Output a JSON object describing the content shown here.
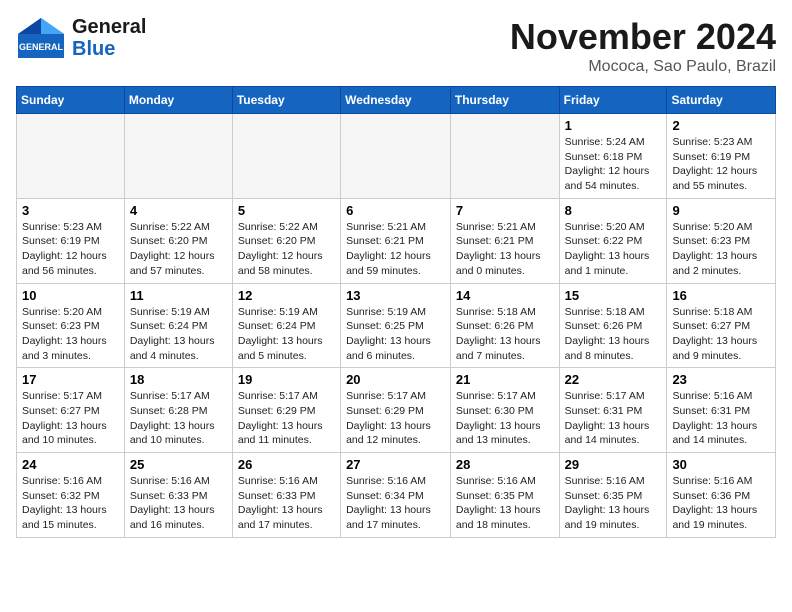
{
  "header": {
    "logo_general": "General",
    "logo_blue": "Blue",
    "month_title": "November 2024",
    "location": "Mococa, Sao Paulo, Brazil"
  },
  "weekdays": [
    "Sunday",
    "Monday",
    "Tuesday",
    "Wednesday",
    "Thursday",
    "Friday",
    "Saturday"
  ],
  "weeks": [
    [
      {
        "day": "",
        "empty": true
      },
      {
        "day": "",
        "empty": true
      },
      {
        "day": "",
        "empty": true
      },
      {
        "day": "",
        "empty": true
      },
      {
        "day": "",
        "empty": true
      },
      {
        "day": "1",
        "sunrise": "Sunrise: 5:24 AM",
        "sunset": "Sunset: 6:18 PM",
        "daylight": "Daylight: 12 hours and 54 minutes."
      },
      {
        "day": "2",
        "sunrise": "Sunrise: 5:23 AM",
        "sunset": "Sunset: 6:19 PM",
        "daylight": "Daylight: 12 hours and 55 minutes."
      }
    ],
    [
      {
        "day": "3",
        "sunrise": "Sunrise: 5:23 AM",
        "sunset": "Sunset: 6:19 PM",
        "daylight": "Daylight: 12 hours and 56 minutes."
      },
      {
        "day": "4",
        "sunrise": "Sunrise: 5:22 AM",
        "sunset": "Sunset: 6:20 PM",
        "daylight": "Daylight: 12 hours and 57 minutes."
      },
      {
        "day": "5",
        "sunrise": "Sunrise: 5:22 AM",
        "sunset": "Sunset: 6:20 PM",
        "daylight": "Daylight: 12 hours and 58 minutes."
      },
      {
        "day": "6",
        "sunrise": "Sunrise: 5:21 AM",
        "sunset": "Sunset: 6:21 PM",
        "daylight": "Daylight: 12 hours and 59 minutes."
      },
      {
        "day": "7",
        "sunrise": "Sunrise: 5:21 AM",
        "sunset": "Sunset: 6:21 PM",
        "daylight": "Daylight: 13 hours and 0 minutes."
      },
      {
        "day": "8",
        "sunrise": "Sunrise: 5:20 AM",
        "sunset": "Sunset: 6:22 PM",
        "daylight": "Daylight: 13 hours and 1 minute."
      },
      {
        "day": "9",
        "sunrise": "Sunrise: 5:20 AM",
        "sunset": "Sunset: 6:23 PM",
        "daylight": "Daylight: 13 hours and 2 minutes."
      }
    ],
    [
      {
        "day": "10",
        "sunrise": "Sunrise: 5:20 AM",
        "sunset": "Sunset: 6:23 PM",
        "daylight": "Daylight: 13 hours and 3 minutes."
      },
      {
        "day": "11",
        "sunrise": "Sunrise: 5:19 AM",
        "sunset": "Sunset: 6:24 PM",
        "daylight": "Daylight: 13 hours and 4 minutes."
      },
      {
        "day": "12",
        "sunrise": "Sunrise: 5:19 AM",
        "sunset": "Sunset: 6:24 PM",
        "daylight": "Daylight: 13 hours and 5 minutes."
      },
      {
        "day": "13",
        "sunrise": "Sunrise: 5:19 AM",
        "sunset": "Sunset: 6:25 PM",
        "daylight": "Daylight: 13 hours and 6 minutes."
      },
      {
        "day": "14",
        "sunrise": "Sunrise: 5:18 AM",
        "sunset": "Sunset: 6:26 PM",
        "daylight": "Daylight: 13 hours and 7 minutes."
      },
      {
        "day": "15",
        "sunrise": "Sunrise: 5:18 AM",
        "sunset": "Sunset: 6:26 PM",
        "daylight": "Daylight: 13 hours and 8 minutes."
      },
      {
        "day": "16",
        "sunrise": "Sunrise: 5:18 AM",
        "sunset": "Sunset: 6:27 PM",
        "daylight": "Daylight: 13 hours and 9 minutes."
      }
    ],
    [
      {
        "day": "17",
        "sunrise": "Sunrise: 5:17 AM",
        "sunset": "Sunset: 6:27 PM",
        "daylight": "Daylight: 13 hours and 10 minutes."
      },
      {
        "day": "18",
        "sunrise": "Sunrise: 5:17 AM",
        "sunset": "Sunset: 6:28 PM",
        "daylight": "Daylight: 13 hours and 10 minutes."
      },
      {
        "day": "19",
        "sunrise": "Sunrise: 5:17 AM",
        "sunset": "Sunset: 6:29 PM",
        "daylight": "Daylight: 13 hours and 11 minutes."
      },
      {
        "day": "20",
        "sunrise": "Sunrise: 5:17 AM",
        "sunset": "Sunset: 6:29 PM",
        "daylight": "Daylight: 13 hours and 12 minutes."
      },
      {
        "day": "21",
        "sunrise": "Sunrise: 5:17 AM",
        "sunset": "Sunset: 6:30 PM",
        "daylight": "Daylight: 13 hours and 13 minutes."
      },
      {
        "day": "22",
        "sunrise": "Sunrise: 5:17 AM",
        "sunset": "Sunset: 6:31 PM",
        "daylight": "Daylight: 13 hours and 14 minutes."
      },
      {
        "day": "23",
        "sunrise": "Sunrise: 5:16 AM",
        "sunset": "Sunset: 6:31 PM",
        "daylight": "Daylight: 13 hours and 14 minutes."
      }
    ],
    [
      {
        "day": "24",
        "sunrise": "Sunrise: 5:16 AM",
        "sunset": "Sunset: 6:32 PM",
        "daylight": "Daylight: 13 hours and 15 minutes."
      },
      {
        "day": "25",
        "sunrise": "Sunrise: 5:16 AM",
        "sunset": "Sunset: 6:33 PM",
        "daylight": "Daylight: 13 hours and 16 minutes."
      },
      {
        "day": "26",
        "sunrise": "Sunrise: 5:16 AM",
        "sunset": "Sunset: 6:33 PM",
        "daylight": "Daylight: 13 hours and 17 minutes."
      },
      {
        "day": "27",
        "sunrise": "Sunrise: 5:16 AM",
        "sunset": "Sunset: 6:34 PM",
        "daylight": "Daylight: 13 hours and 17 minutes."
      },
      {
        "day": "28",
        "sunrise": "Sunrise: 5:16 AM",
        "sunset": "Sunset: 6:35 PM",
        "daylight": "Daylight: 13 hours and 18 minutes."
      },
      {
        "day": "29",
        "sunrise": "Sunrise: 5:16 AM",
        "sunset": "Sunset: 6:35 PM",
        "daylight": "Daylight: 13 hours and 19 minutes."
      },
      {
        "day": "30",
        "sunrise": "Sunrise: 5:16 AM",
        "sunset": "Sunset: 6:36 PM",
        "daylight": "Daylight: 13 hours and 19 minutes."
      }
    ]
  ]
}
